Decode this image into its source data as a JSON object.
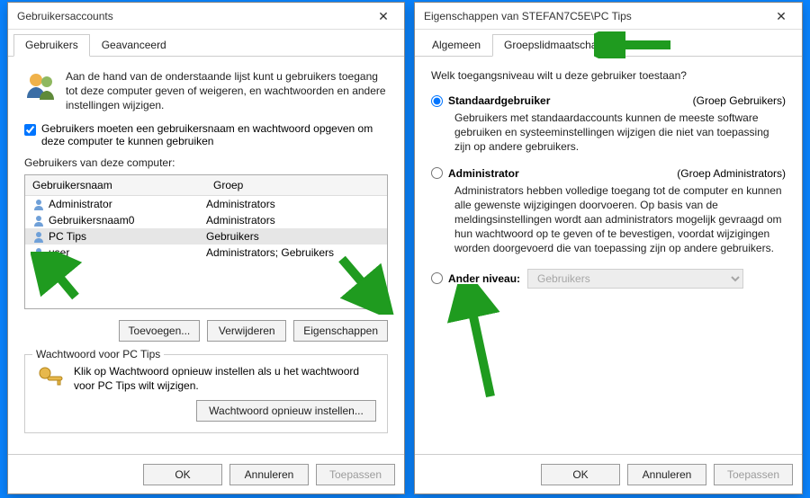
{
  "left": {
    "title": "Gebruikersaccounts",
    "tabs": {
      "users": "Gebruikers",
      "advanced": "Geavanceerd"
    },
    "intro": "Aan de hand van de onderstaande lijst kunt u gebruikers toegang tot deze computer geven of weigeren, en wachtwoorden en andere instellingen wijzigen.",
    "checkbox": "Gebruikers moeten een gebruikersnaam en wachtwoord opgeven om deze computer te kunnen gebruiken",
    "list_label": "Gebruikers van deze computer:",
    "headers": {
      "name": "Gebruikersnaam",
      "group": "Groep"
    },
    "rows": [
      {
        "name": "Administrator",
        "group": "Administrators"
      },
      {
        "name": "Gebruikersnaam0",
        "group": "Administrators"
      },
      {
        "name": "PC Tips",
        "group": "Gebruikers"
      },
      {
        "name": "user",
        "group": "Administrators; Gebruikers"
      }
    ],
    "btn_add": "Toevoegen...",
    "btn_remove": "Verwijderen",
    "btn_props": "Eigenschappen",
    "pw_legend": "Wachtwoord voor PC Tips",
    "pw_text": "Klik op Wachtwoord opnieuw instellen als u het wachtwoord voor PC Tips wilt wijzigen.",
    "pw_btn": "Wachtwoord opnieuw instellen..."
  },
  "right": {
    "title": "Eigenschappen van STEFAN7C5E\\PC Tips",
    "tabs": {
      "general": "Algemeen",
      "membership": "Groepslidmaatschap"
    },
    "question": "Welk toegangsniveau wilt u deze gebruiker toestaan?",
    "std_label": "Standaardgebruiker",
    "std_hint": "(Groep Gebruikers)",
    "std_body": "Gebruikers met standaardaccounts kunnen de meeste software gebruiken en systeeminstellingen wijzigen die niet van toepassing zijn op andere gebruikers.",
    "admin_label": "Administrator",
    "admin_hint": "(Groep Administrators)",
    "admin_body": "Administrators hebben volledige toegang tot de computer en kunnen alle gewenste wijzigingen doorvoeren. Op basis van de meldingsinstellingen wordt aan administrators mogelijk gevraagd om hun wachtwoord op te geven of te bevestigen, voordat wijzigingen worden doorgevoerd die van toepassing zijn op andere gebruikers.",
    "other_label": "Ander niveau:",
    "other_value": "Gebruikers"
  },
  "footer": {
    "ok": "OK",
    "cancel": "Annuleren",
    "apply": "Toepassen"
  }
}
